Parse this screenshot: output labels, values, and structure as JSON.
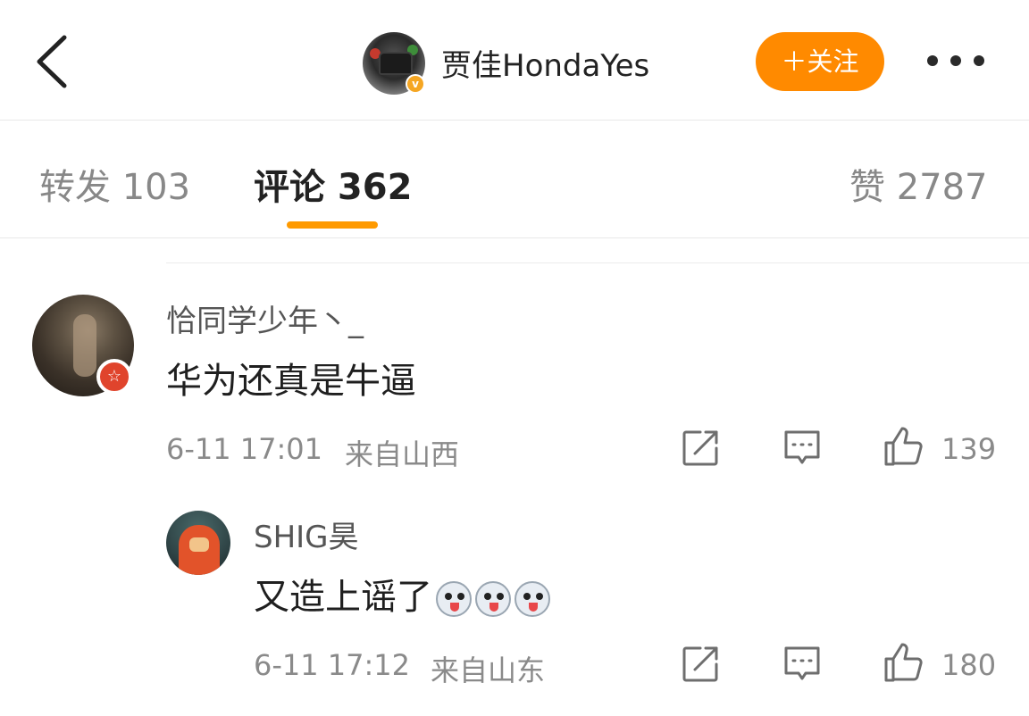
{
  "header": {
    "author_name": "贾佳HondaYes",
    "verified_badge": "v",
    "follow_label": "＋关注",
    "icons": [
      "back-chevron-icon",
      "more-dots-icon"
    ]
  },
  "tabs": [
    {
      "label": "转发 103"
    },
    {
      "label": "评论 362"
    },
    {
      "label": "赞 2787"
    }
  ],
  "active_tab_index": 1,
  "colors": {
    "accent": "#ff8a00",
    "tab_underline": "#ff9a00",
    "verified": "#f5a623",
    "user_badge": "#e0442c"
  },
  "comments": [
    {
      "username": "恰同学少年丶_",
      "text": "华为还真是牛逼",
      "time": "6-11 17:01",
      "location": "来自山西",
      "likes": "139",
      "badge": "☆"
    }
  ],
  "replies": [
    {
      "username": "SHIG昊",
      "text": "又造上谣了",
      "emoji": [
        "husky-emoji",
        "husky-emoji",
        "husky-emoji"
      ],
      "time": "6-11 17:12",
      "location": "来自山东",
      "likes": "180"
    }
  ]
}
